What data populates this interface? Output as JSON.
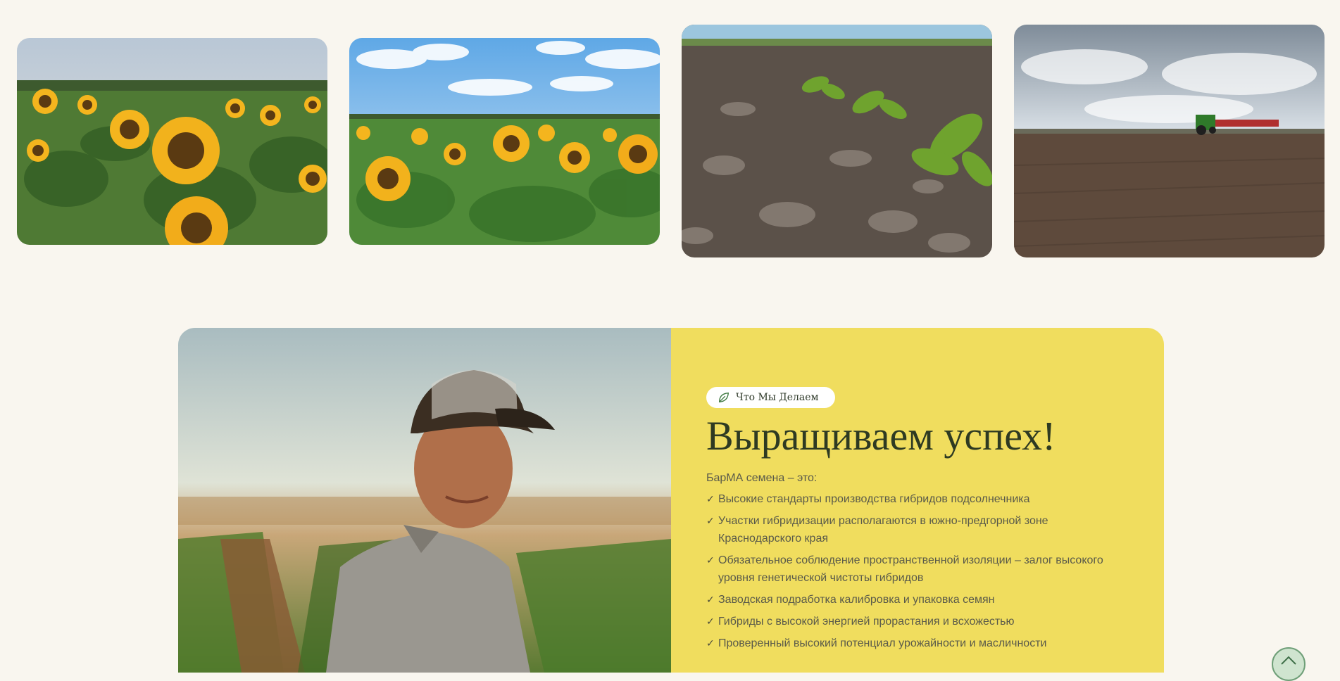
{
  "gallery": {
    "images": [
      {
        "subject": "sunflower-field-closeup"
      },
      {
        "subject": "sunflower-field-sky"
      },
      {
        "subject": "seedlings-in-soil"
      },
      {
        "subject": "tractor-plowed-field"
      }
    ]
  },
  "about": {
    "photo_subject": "farmer-in-field",
    "badge_icon": "leaf-icon",
    "badge_label": "Что Мы Делаем",
    "title": "Выращиваем успех!",
    "intro": "БарМА семена – это:",
    "check_mark": "✓",
    "features": [
      "Высокие стандарты производства гибридов подсолнечника",
      "Участки гибридизации располагаются в южно-предгорной зоне Краснодарского края",
      "Обязательное соблюдение пространственной изоляции – залог высокого уровня генетической чистоты гибридов",
      "Заводская подработка калибровка и упаковка семян",
      "Гибриды с высокой энергией прорастания и всхожестью",
      "Проверенный высокий потенциал урожайности и масличности"
    ],
    "panel_color": "#f0dd5e"
  },
  "scroll_top": {
    "icon": "chevron-up-icon"
  }
}
